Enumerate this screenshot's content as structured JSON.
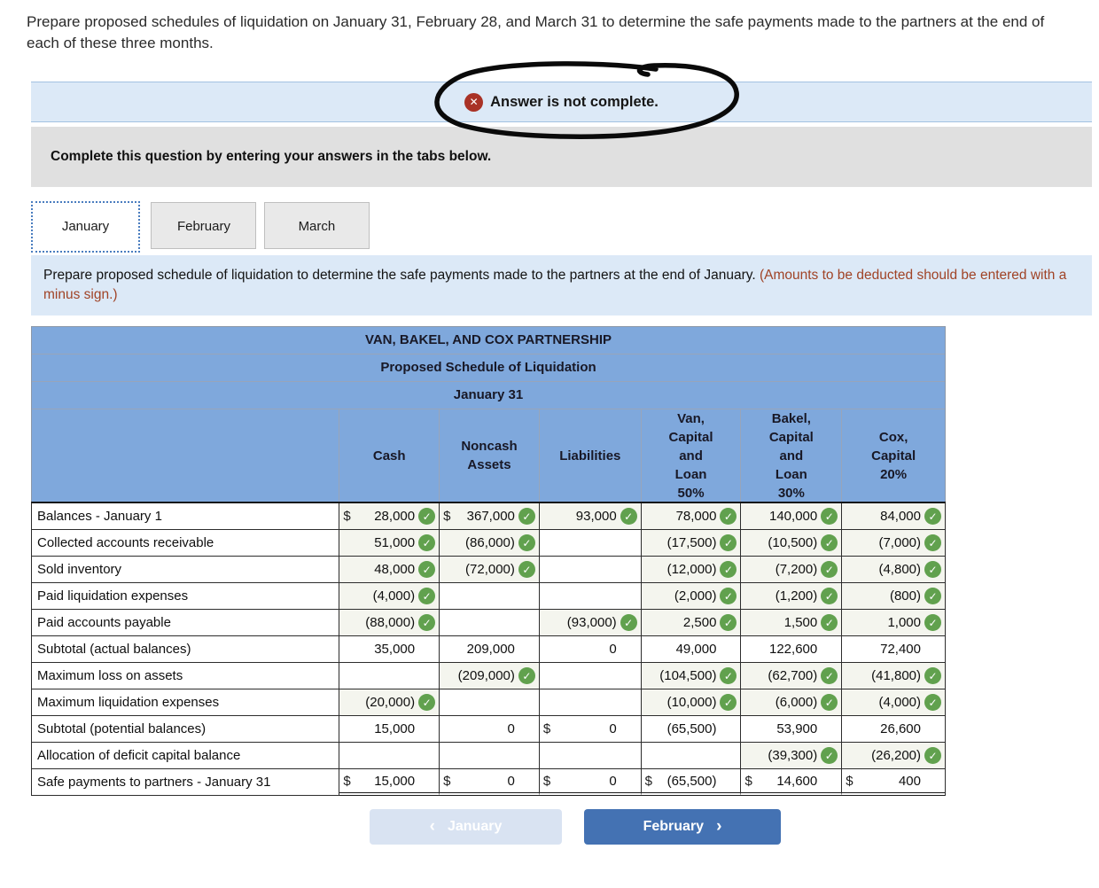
{
  "page": {
    "heading": "Prepare proposed schedules of liquidation on January 31, February 28, and March 31 to determine the safe payments made to the partners at the end of each of these three months.",
    "status_banner": {
      "text": "Answer is not complete.",
      "icon": "error-x-icon"
    },
    "subheader": "Complete this question by entering your answers in the tabs below.",
    "tabs": [
      {
        "label": "January",
        "active": true
      },
      {
        "label": "February",
        "active": false
      },
      {
        "label": "March",
        "active": false
      }
    ],
    "instruction": {
      "main": "Prepare proposed schedule of liquidation to determine the safe payments made to the partners at the end of January. ",
      "note": "(Amounts to be deducted should be entered with a minus sign.)"
    }
  },
  "icons": {
    "check": "✓",
    "error": "✕"
  },
  "colors": {
    "header_blue": "#7fa8dc",
    "banner_blue": "#dce9f7",
    "panel_gray": "#e0e0e0",
    "check_green": "#61a14e",
    "error_red": "#a93226",
    "note_red": "#a04326",
    "filled_cell": "#f4f5ee",
    "next_button_blue": "#4472b3",
    "prev_button_pale": "#d9e3f2"
  },
  "table": {
    "titles": [
      "VAN, BAKEL, AND COX PARTNERSHIP",
      "Proposed Schedule of Liquidation",
      "January 31"
    ],
    "columns": [
      "",
      "Cash",
      "Noncash\nAssets",
      "Liabilities",
      "Van,\nCapital\nand\nLoan\n50%",
      "Bakel,\nCapital\nand\nLoan\n30%",
      "Cox,\nCapital\n20%"
    ],
    "rows": [
      {
        "label": "Balances - January 1",
        "type": "entry",
        "cells": [
          {
            "dollar": true,
            "value": "28,000",
            "check": true
          },
          {
            "dollar": true,
            "value": "367,000",
            "check": true
          },
          {
            "value": "93,000",
            "check": true
          },
          {
            "value": "78,000",
            "check": true
          },
          {
            "value": "140,000",
            "check": true
          },
          {
            "value": "84,000",
            "check": true
          }
        ]
      },
      {
        "label": "Collected accounts receivable",
        "type": "entry",
        "cells": [
          {
            "value": "51,000",
            "check": true
          },
          {
            "value": "(86,000)",
            "check": true
          },
          {},
          {
            "value": "(17,500)",
            "check": true
          },
          {
            "value": "(10,500)",
            "check": true
          },
          {
            "value": "(7,000)",
            "check": true
          }
        ]
      },
      {
        "label": "Sold inventory",
        "type": "entry",
        "cells": [
          {
            "value": "48,000",
            "check": true
          },
          {
            "value": "(72,000)",
            "check": true
          },
          {},
          {
            "value": "(12,000)",
            "check": true
          },
          {
            "value": "(7,200)",
            "check": true
          },
          {
            "value": "(4,800)",
            "check": true
          }
        ]
      },
      {
        "label": "Paid liquidation expenses",
        "type": "entry",
        "cells": [
          {
            "value": "(4,000)",
            "check": true
          },
          {},
          {},
          {
            "value": "(2,000)",
            "check": true
          },
          {
            "value": "(1,200)",
            "check": true
          },
          {
            "value": "(800)",
            "check": true
          }
        ]
      },
      {
        "label": "Paid accounts payable",
        "type": "entry",
        "cells": [
          {
            "value": "(88,000)",
            "check": true
          },
          {},
          {
            "value": "(93,000)",
            "check": true
          },
          {
            "value": "2,500",
            "check": true
          },
          {
            "value": "1,500",
            "check": true
          },
          {
            "value": "1,000",
            "check": true
          }
        ]
      },
      {
        "label": "Subtotal (actual balances)",
        "type": "computed",
        "cells": [
          {
            "value": "35,000"
          },
          {
            "value": "209,000"
          },
          {
            "value": "0"
          },
          {
            "value": "49,000"
          },
          {
            "value": "122,600"
          },
          {
            "value": "72,400"
          }
        ]
      },
      {
        "label": "Maximum loss on assets",
        "type": "entry",
        "cells": [
          {},
          {
            "value": "(209,000)",
            "check": true
          },
          {},
          {
            "value": "(104,500)",
            "check": true
          },
          {
            "value": "(62,700)",
            "check": true
          },
          {
            "value": "(41,800)",
            "check": true
          }
        ]
      },
      {
        "label": "Maximum liquidation expenses",
        "type": "entry",
        "cells": [
          {
            "value": "(20,000)",
            "check": true
          },
          {},
          {},
          {
            "value": "(10,000)",
            "check": true
          },
          {
            "value": "(6,000)",
            "check": true
          },
          {
            "value": "(4,000)",
            "check": true
          }
        ]
      },
      {
        "label": "Subtotal (potential balances)",
        "type": "computed",
        "cells": [
          {
            "value": "15,000"
          },
          {
            "value": "0"
          },
          {
            "dollar": true,
            "value": "0"
          },
          {
            "value": "(65,500)"
          },
          {
            "value": "53,900"
          },
          {
            "value": "26,600"
          }
        ]
      },
      {
        "label": "Allocation of deficit capital balance",
        "type": "entry",
        "cells": [
          {},
          {},
          {},
          {},
          {
            "value": "(39,300)",
            "check": true
          },
          {
            "value": "(26,200)",
            "check": true
          }
        ]
      },
      {
        "label": "Safe payments to partners - January 31",
        "type": "computed",
        "cells": [
          {
            "dollar": true,
            "value": "15,000"
          },
          {
            "dollar": true,
            "value": "0"
          },
          {
            "dollar": true,
            "value": "0"
          },
          {
            "dollar": true,
            "value": "(65,500)"
          },
          {
            "dollar": true,
            "value": "14,600"
          },
          {
            "dollar": true,
            "value": "400"
          }
        ]
      }
    ]
  },
  "footer": {
    "prev_button": {
      "chevron": "‹",
      "label": "January"
    },
    "next_button": {
      "label": "February",
      "chevron": "›"
    }
  }
}
